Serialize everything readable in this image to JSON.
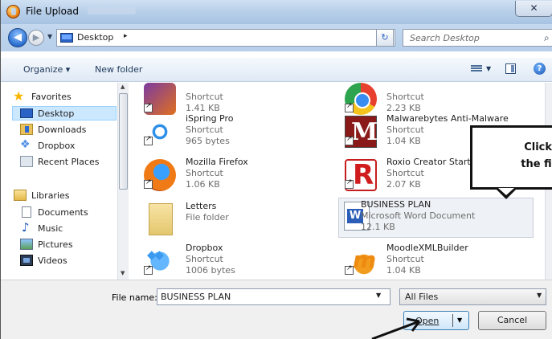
{
  "window": {
    "title": "File Upload",
    "close_glyph": "✕"
  },
  "nav": {
    "back_glyph": "◀",
    "forward_glyph": "▶",
    "location": "Desktop",
    "location_sep": "▸",
    "search_placeholder": "Search Desktop",
    "refresh_glyph": "↻"
  },
  "toolbar": {
    "organize": "Organize ▾",
    "new_folder": "New folder",
    "help": "?"
  },
  "sidebar": {
    "favorites": "Favorites",
    "desktop": "Desktop",
    "downloads": "Downloads",
    "dropbox": "Dropbox",
    "recent": "Recent Places",
    "libraries": "Libraries",
    "documents": "Documents",
    "music": "Music",
    "pictures": "Pictures",
    "videos": "Videos"
  },
  "files": {
    "f1": {
      "l2": "Shortcut",
      "l3": "1.41 KB"
    },
    "f2": {
      "l2": "Shortcut",
      "l3": "2.23 KB"
    },
    "f3": {
      "name": "iSpring Pro",
      "l2": "Shortcut",
      "l3": "965 bytes"
    },
    "f4": {
      "name": "Malwarebytes Anti-Malware",
      "l2": "Shortcut",
      "l3": "1.04 KB"
    },
    "f5": {
      "name": "Mozilla Firefox",
      "l2": "Shortcut",
      "l3": "1.06 KB"
    },
    "f6": {
      "name": "Roxio Creator Starter",
      "l2": "Shortcut",
      "l3": "2.07 KB"
    },
    "f7": {
      "name": "Letters",
      "l2": "File folder"
    },
    "f8": {
      "name": "BUSINESS PLAN",
      "l2": "Microsoft Word Document",
      "l3": "12.1 KB"
    },
    "f9": {
      "name": "Dropbox",
      "l2": "Shortcut",
      "l3": "1006 bytes"
    },
    "f10": {
      "name": "MoodleXMLBuilder",
      "l2": "Shortcut",
      "l3": "1.04 KB"
    }
  },
  "bottom": {
    "filename_label": "File name:",
    "filename_value": "BUSINESS PLAN",
    "filter": "All Files",
    "open": "Open",
    "cancel": "Cancel"
  },
  "callout": {
    "line1": "Click on",
    "line2": "the file n"
  }
}
